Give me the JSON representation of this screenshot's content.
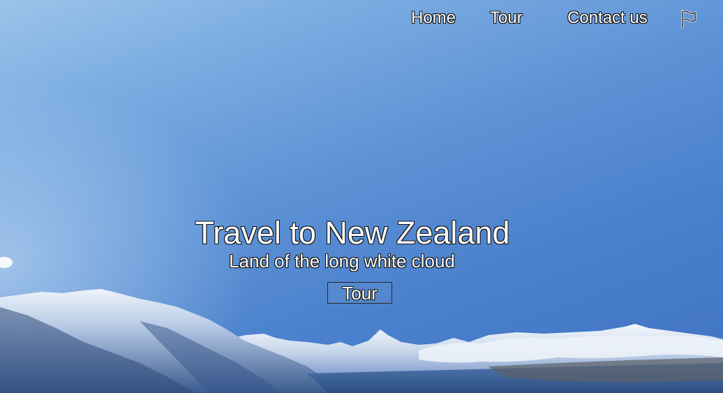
{
  "nav": {
    "items": [
      {
        "label": "Home"
      },
      {
        "label": "Tour"
      },
      {
        "label": "Contact us"
      }
    ],
    "flag_icon": "flag-icon"
  },
  "hero": {
    "title": "Travel to New Zealand",
    "subtitle": "Land of the long white cloud",
    "cta_label": "Tour"
  },
  "colors": {
    "sky_top": "#9cc4ea",
    "sky_bottom": "#3f73c3",
    "text": "#ffffff",
    "text_outline": "#111111"
  }
}
